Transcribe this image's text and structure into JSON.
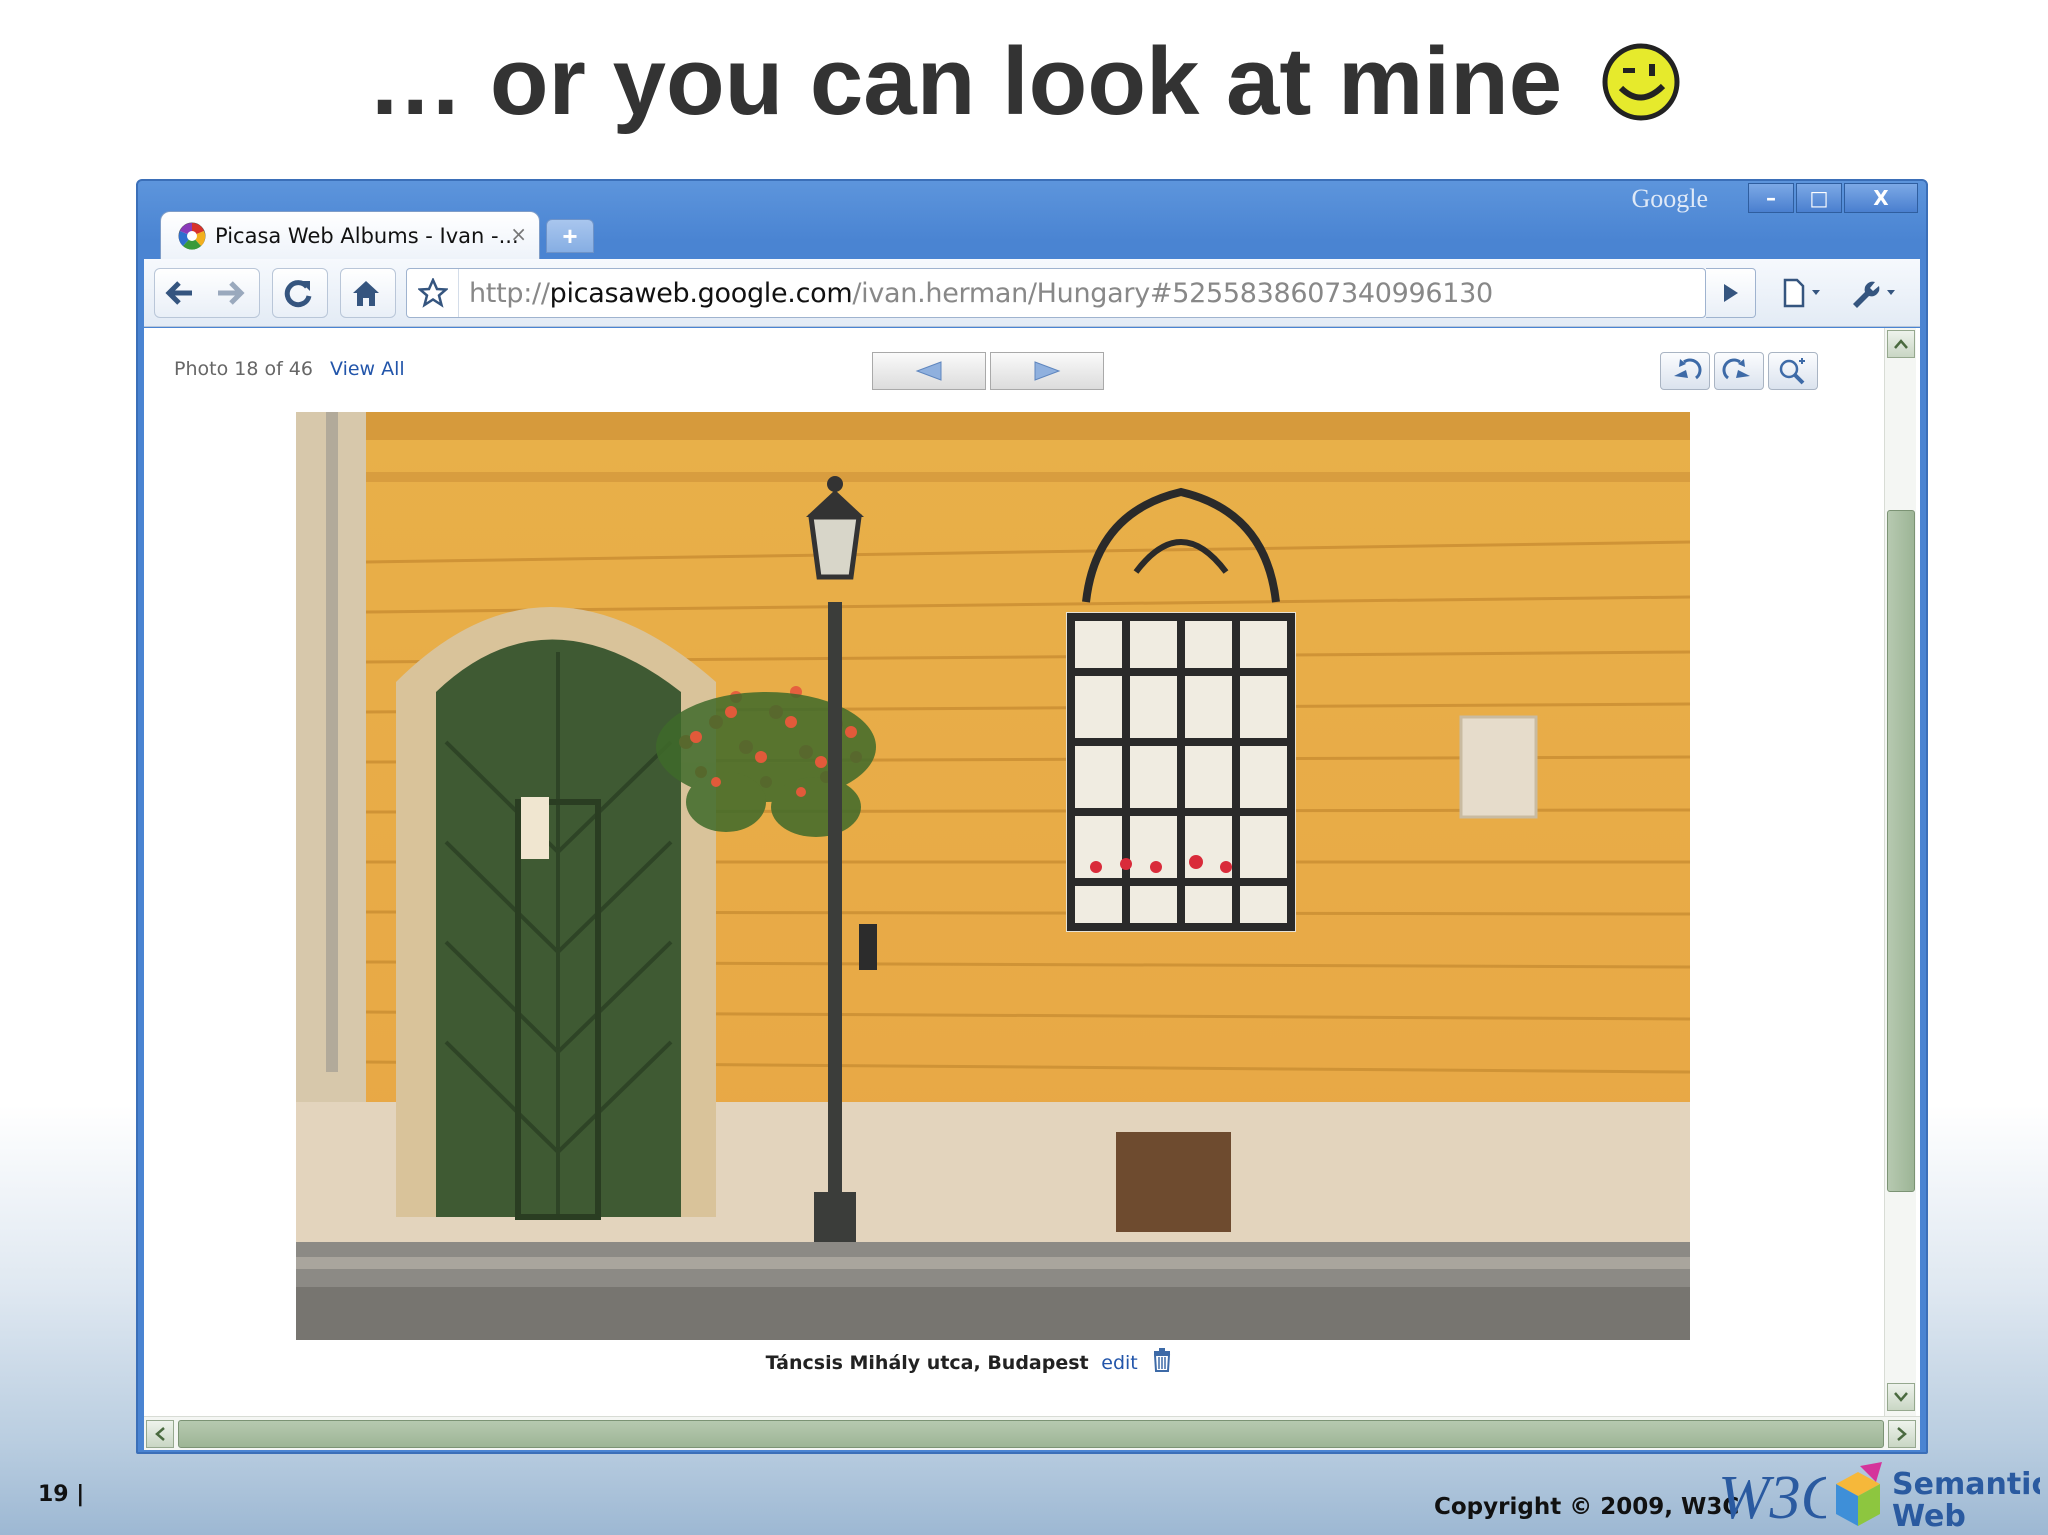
{
  "slide": {
    "title": "… or you can look at mine",
    "page_number": "19 |",
    "copyright": "Copyright © 2009, W3C"
  },
  "window": {
    "brand": "Google",
    "tab_title": "Picasa Web Albums - Ivan -...",
    "tab_close": "×",
    "new_tab": "+",
    "controls": {
      "minimize": "–",
      "maximize": "□",
      "close": "X"
    }
  },
  "toolbar": {
    "url_scheme": "http://",
    "url_host": "picasaweb.google.com",
    "url_path": "/ivan.herman/Hungary#5255838607340996130"
  },
  "viewer": {
    "photo_count": "Photo 18 of 46",
    "view_all": "View All",
    "caption": "Táncsis Mihály utca, Budapest",
    "edit": "edit"
  },
  "logos": {
    "w3c": "W3C",
    "semantic_web_line1": "Semantic",
    "semantic_web_line2": "Web"
  },
  "colors": {
    "window_frame": "#4a84d2",
    "wall": "#e9a94a",
    "door": "#3f5a33",
    "link": "#2255aa",
    "scroll_thumb": "#9db596"
  }
}
